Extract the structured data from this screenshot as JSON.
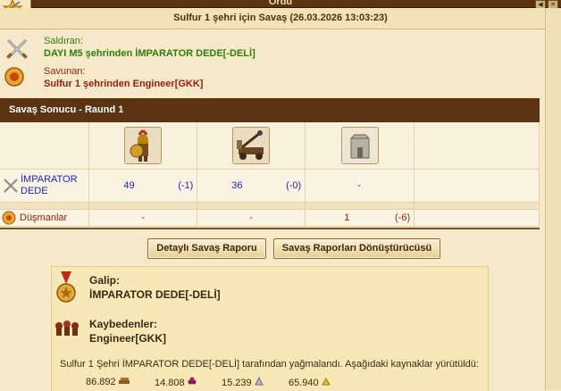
{
  "window": {
    "title": "Ordu"
  },
  "header": {
    "title": "Sulfur 1 şehri için Savaş (26.03.2026 13:03:23)"
  },
  "attacker": {
    "label": "Saldıran:",
    "value": "DAYI M5 şehrinden İMPARATOR DEDE[-DELİ]"
  },
  "defender": {
    "label": "Savunan:",
    "value": "Sulfur 1 şehrinden Engineer[GKK]"
  },
  "section": {
    "title": "Savaş Sonucu - Raund 1"
  },
  "units": [
    "hoplite-icon",
    "catapult-icon",
    "wall-icon"
  ],
  "own_row": {
    "name": "İMPARATOR DEDE",
    "cells": [
      {
        "count": "49",
        "loss": "(-1)"
      },
      {
        "count": "36",
        "loss": "(-0)"
      },
      {
        "count": "-",
        "loss": ""
      }
    ]
  },
  "enemy_row": {
    "name": "Düşmanlar",
    "cells": [
      {
        "count": "-",
        "loss": ""
      },
      {
        "count": "-",
        "loss": ""
      },
      {
        "count": "1",
        "loss": "(-6)"
      }
    ]
  },
  "buttons": {
    "detail": "Detaylı Savaş Raporu",
    "converter": "Savaş Raporları Dönüştürücüsü"
  },
  "summary": {
    "winner_label": "Galip:",
    "winner_value": "İMPARATOR DEDE[-DELİ]",
    "loser_label": "Kaybedenler:",
    "loser_value": "Engineer[GKK]",
    "loot_text": "Sulfur 1 Şehri İMPARATOR DEDE[-DELİ] tarafından yağmalandı. Aşağıdaki kaynaklar yürütüldü:",
    "resources": [
      {
        "amount": "86.892",
        "icon": "wood-icon"
      },
      {
        "amount": "14.808",
        "icon": "wine-icon"
      },
      {
        "amount": "15.239",
        "icon": "marble-icon"
      },
      {
        "amount": "65.940",
        "icon": "sulfur-icon"
      }
    ]
  },
  "colors": {
    "header_bar": "#5a3412",
    "attacker": "#2f7d0c",
    "defender": "#9c1b0c",
    "numbers": "#1f23c8"
  }
}
